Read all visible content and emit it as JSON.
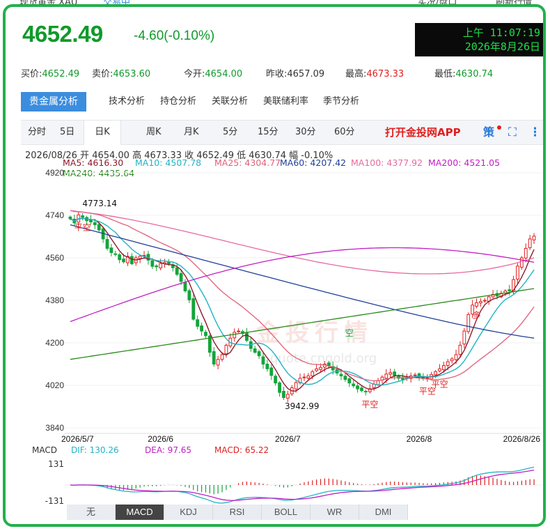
{
  "top_cut": {
    "left_title": "现货黄金 XAU",
    "left_status": "交易中",
    "right_a": "实况/盘口",
    "right_b": "刷新行情"
  },
  "price": {
    "last": "4652.49",
    "change": "-4.60(-0.10%)"
  },
  "clock": {
    "line1": "上午 11:07:19",
    "line2": "2026年8月26日"
  },
  "quotes": [
    {
      "label": "买价:",
      "value": "4652.49",
      "color": "g"
    },
    {
      "label": "卖价:",
      "value": "4653.60",
      "color": "g"
    },
    {
      "label": "今开:",
      "value": "4654.00",
      "color": "g"
    },
    {
      "label": "昨收:",
      "value": "4657.09",
      "color": "k"
    },
    {
      "label": "最高:",
      "value": "4673.33",
      "color": "r"
    },
    {
      "label": "最低:",
      "value": "4630.74",
      "color": "g"
    }
  ],
  "analysis_tabs": [
    "贵金属分析",
    "技术分析",
    "持仓分析",
    "关联分析",
    "美联储利率",
    "季节分析"
  ],
  "period_tabs": [
    "分时",
    "5日",
    "日K",
    "周K",
    "月K",
    "5分",
    "15分",
    "30分",
    "60分"
  ],
  "period_active": "日K",
  "app_link": "打开金投网APP",
  "icons": {
    "strategy": "策",
    "fullscreen": "fullscreen-icon",
    "more": "more-icon"
  },
  "ohlc": "2026/08/26 开 4654.00 高 4673.33 收 4652.49 低 4630.74 幅 -0.10%",
  "ma": [
    {
      "label": "MA5: 4616.30",
      "color": "#8b1a2b"
    },
    {
      "label": "MA10: 4507.78",
      "color": "#21b3c6"
    },
    {
      "label": "MA25: 4304.77",
      "color": "#e0607a"
    },
    {
      "label": "MA60: 4207.42",
      "color": "#1f3f9a"
    },
    {
      "label": "MA100: 4377.92",
      "color": "#e66aa0"
    },
    {
      "label": "MA200: 4521.05",
      "color": "#c21ec7"
    },
    {
      "label": "MA240: 4435.64",
      "color": "#2a8a1a"
    }
  ],
  "y_ticks": [
    "4920",
    "4740",
    "4560",
    "4380",
    "4200",
    "4020",
    "3840"
  ],
  "x_ticks": [
    "2026/5/7",
    "2026/6",
    "2026/7",
    "2026/8",
    "2026/8/26"
  ],
  "annotations": {
    "high_label": "4773.14",
    "low_label": "3942.99",
    "ping_kong": "平空",
    "kong": "空",
    "duo": "多"
  },
  "macd": {
    "label": "MACD",
    "dif": "DIF: 130.26",
    "dea": "DEA: 97.65",
    "macd": "MACD: 65.22",
    "tick_top": "131",
    "tick_bottom": "-131"
  },
  "indicator_tabs": [
    "无",
    "MACD",
    "KDJ",
    "RSI",
    "BOLL",
    "WR",
    "DMI"
  ],
  "indicator_active": "MACD",
  "watermark": "金投行情",
  "watermark_url": "quote.cngold.org",
  "colors": {
    "up": "#e02020",
    "down": "#13a53a",
    "frame": "#22b14c",
    "tab_active": "#3c8dde"
  },
  "chart_data": {
    "type": "candlestick",
    "ylim": [
      3840,
      4920
    ],
    "closes": [
      4725,
      4708,
      4742,
      4731,
      4717,
      4712,
      4700,
      4678,
      4640,
      4600,
      4582,
      4574,
      4552,
      4543,
      4566,
      4535,
      4560,
      4567,
      4570,
      4550,
      4524,
      4522,
      4536,
      4540,
      4535,
      4518,
      4490,
      4460,
      4420,
      4382,
      4300,
      4270,
      4250,
      4230,
      4160,
      4110,
      4130,
      4150,
      4190,
      4220,
      4245,
      4250,
      4240,
      4210,
      4176,
      4160,
      4145,
      4110,
      4090,
      4062,
      4030,
      3990,
      3968,
      3982,
      4010,
      4032,
      4050,
      4055,
      4060,
      4078,
      4090,
      4096,
      4110,
      4102,
      4085,
      4072,
      4060,
      4045,
      4030,
      4018,
      4005,
      3998,
      3992,
      4005,
      4025,
      4040,
      4055,
      4068,
      4074,
      4062,
      4050,
      4045,
      4052,
      4060,
      4064,
      4055,
      4048,
      4052,
      4066,
      4078,
      4090,
      4104,
      4120,
      4132,
      4150,
      4190,
      4250,
      4320,
      4360,
      4370,
      4375,
      4380,
      4395,
      4405,
      4398,
      4410,
      4420,
      4420,
      4468,
      4525,
      4560,
      4600,
      4640,
      4652
    ]
  }
}
